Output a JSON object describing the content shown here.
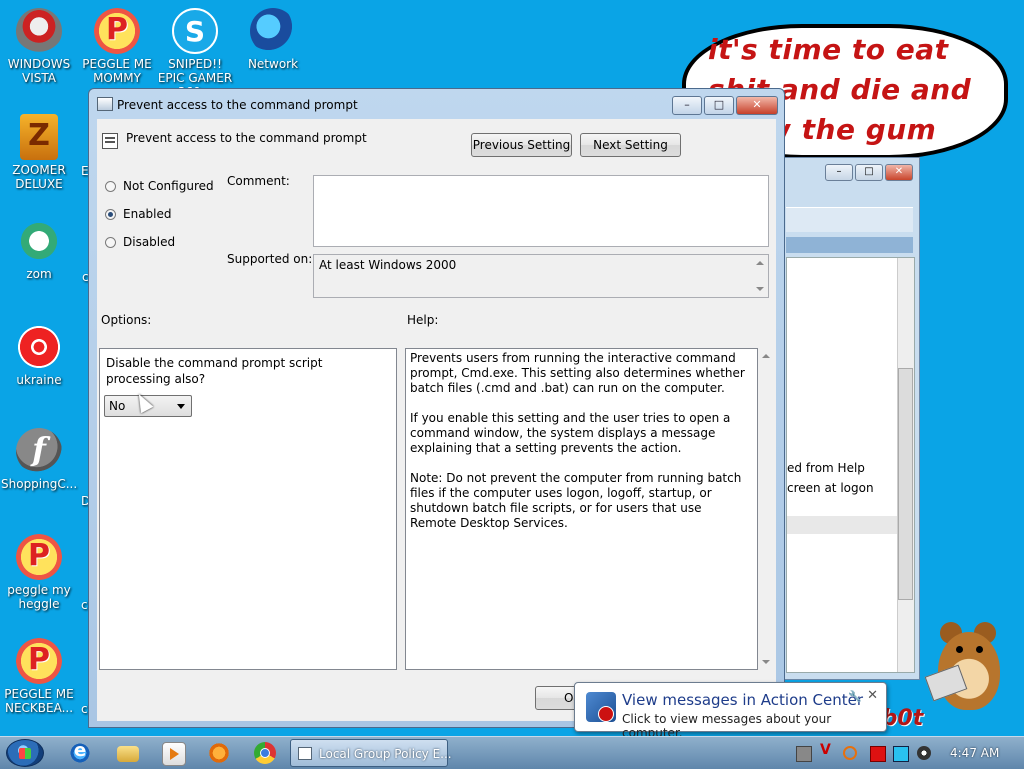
{
  "desktop": {
    "icons": [
      {
        "label": "WINDOWS VISTA"
      },
      {
        "label": "PEGGLE ME MOMMY"
      },
      {
        "label": "SNIPED!! EPIC GAMER 360..."
      },
      {
        "label": "Network"
      },
      {
        "label": "ZOOMER DELUXE"
      },
      {
        "label": "zom"
      },
      {
        "label": "ukraine"
      },
      {
        "label": "ShoppingC..."
      },
      {
        "label": "peggle my heggle"
      },
      {
        "label": "PEGGLE ME NECKBEA..."
      }
    ],
    "partial_labels": [
      "c",
      "E",
      "D",
      "c",
      "c"
    ],
    "bubble_text": "it's time to eat shit and die and chew the gum",
    "hamster_text": "ub0t"
  },
  "background_window": {
    "lines": [
      "ed from Help",
      "creen at logon"
    ]
  },
  "dialog": {
    "title": "Prevent access to the command prompt",
    "header_title": "Prevent access to the command prompt",
    "previous_label": "Previous Setting",
    "next_label": "Next Setting",
    "radios": [
      {
        "label": "Not Configured",
        "selected": false
      },
      {
        "label": "Enabled",
        "selected": true
      },
      {
        "label": "Disabled",
        "selected": false
      }
    ],
    "comment_label": "Comment:",
    "comment_value": "",
    "supported_label": "Supported on:",
    "supported_value": "At least Windows 2000",
    "options_label": "Options:",
    "help_label": "Help:",
    "option_question": "Disable the command prompt script processing also?",
    "option_value": "No",
    "help_text": "Prevents users from running the interactive command prompt, Cmd.exe. This setting also determines whether batch files (.cmd and .bat) can run on the computer.\n\nIf you enable this setting and the user tries to open a command window, the system displays a message explaining that a setting prevents the action.\n\nNote: Do not prevent the computer from running batch files if the computer uses logon, logoff, startup, or shutdown batch file scripts, or for users that use Remote Desktop Services.",
    "ok_label": "O"
  },
  "notification": {
    "title": "View messages in Action Center",
    "body": "Click to view messages about your computer."
  },
  "taskbar": {
    "task_label": "Local Group Policy E...",
    "clock": "4:47 AM"
  },
  "colors": {
    "desktop_bg": "#0aa4e6",
    "bubble_text": "#c51414",
    "notification_title": "#1e3c8a"
  }
}
